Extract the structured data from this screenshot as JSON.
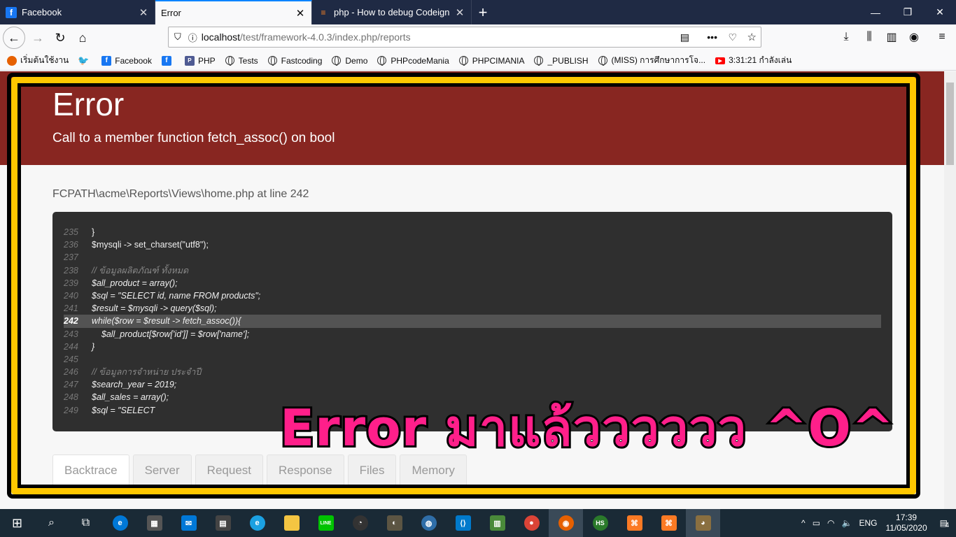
{
  "browser": {
    "tabs": [
      {
        "label": "Facebook",
        "icon": "f",
        "icon_color": "#1877f2",
        "active": false
      },
      {
        "label": "Error",
        "icon": "",
        "icon_color": "",
        "active": true
      },
      {
        "label": "php - How to debug Codeignit",
        "icon": "S",
        "icon_color": "#f48024",
        "active": false
      }
    ],
    "url_host": "localhost",
    "url_path": "/test/framework-4.0.3/index.php/reports"
  },
  "bookmarks": [
    {
      "label": "เริ่มต้นใช้งาน",
      "icon": "firefox"
    },
    {
      "label": "",
      "icon": "twitter"
    },
    {
      "label": "Facebook",
      "icon": "facebook"
    },
    {
      "label": "",
      "icon": "facebook"
    },
    {
      "label": "PHP",
      "icon": "php"
    },
    {
      "label": "Tests",
      "icon": "globe"
    },
    {
      "label": "Fastcoding",
      "icon": "globe"
    },
    {
      "label": "Demo",
      "icon": "globe"
    },
    {
      "label": "PHPcodeMania",
      "icon": "globe"
    },
    {
      "label": "PHPCIMANIA",
      "icon": "globe"
    },
    {
      "label": "_PUBLISH",
      "icon": "globe"
    },
    {
      "label": "(MISS) การศึกษาการโจ...",
      "icon": "globe"
    },
    {
      "label": "3:31:21  กำลังเล่น",
      "icon": "youtube"
    }
  ],
  "page": {
    "title": "Error",
    "message": "Call to a member function fetch_assoc() on bool",
    "path": "FCPATH\\acme\\Reports\\Views\\home.php at line 242",
    "code_lines": [
      {
        "n": "235",
        "t": "}"
      },
      {
        "n": "236",
        "t": "$mysqli -> set_charset(\"utf8\");"
      },
      {
        "n": "237",
        "t": ""
      },
      {
        "n": "238",
        "t": "// ข้อมูลผลิตภัณฑ์ ทั้งหมด"
      },
      {
        "n": "239",
        "t": "$all_product = array();"
      },
      {
        "n": "240",
        "t": "$sql = \"SELECT id, name FROM products\";"
      },
      {
        "n": "241",
        "t": "$result = $mysqli -> query($sql);"
      },
      {
        "n": "242",
        "t": "while($row = $result -> fetch_assoc()){"
      },
      {
        "n": "243",
        "t": "    $all_product[$row['id']] = $row['name'];"
      },
      {
        "n": "244",
        "t": "}"
      },
      {
        "n": "245",
        "t": ""
      },
      {
        "n": "246",
        "t": "// ข้อมูลการจำหน่าย ประจำปี"
      },
      {
        "n": "247",
        "t": "$search_year = 2019;"
      },
      {
        "n": "248",
        "t": "$all_sales = array();"
      },
      {
        "n": "249",
        "t": "$sql = \"SELECT"
      }
    ],
    "highlight_line": "242",
    "debug_tabs": [
      "Backtrace",
      "Server",
      "Request",
      "Response",
      "Files",
      "Memory"
    ]
  },
  "overlay_text": "Error มาแล้วววววว ^O^",
  "taskbar": {
    "lang": "ENG",
    "time": "17:39",
    "date": "11/05/2020",
    "notifications": "4"
  },
  "colors": {
    "header_bg": "#882621",
    "frame_yellow": "#ffc700",
    "overlay_fill": "#ff1f8a"
  }
}
